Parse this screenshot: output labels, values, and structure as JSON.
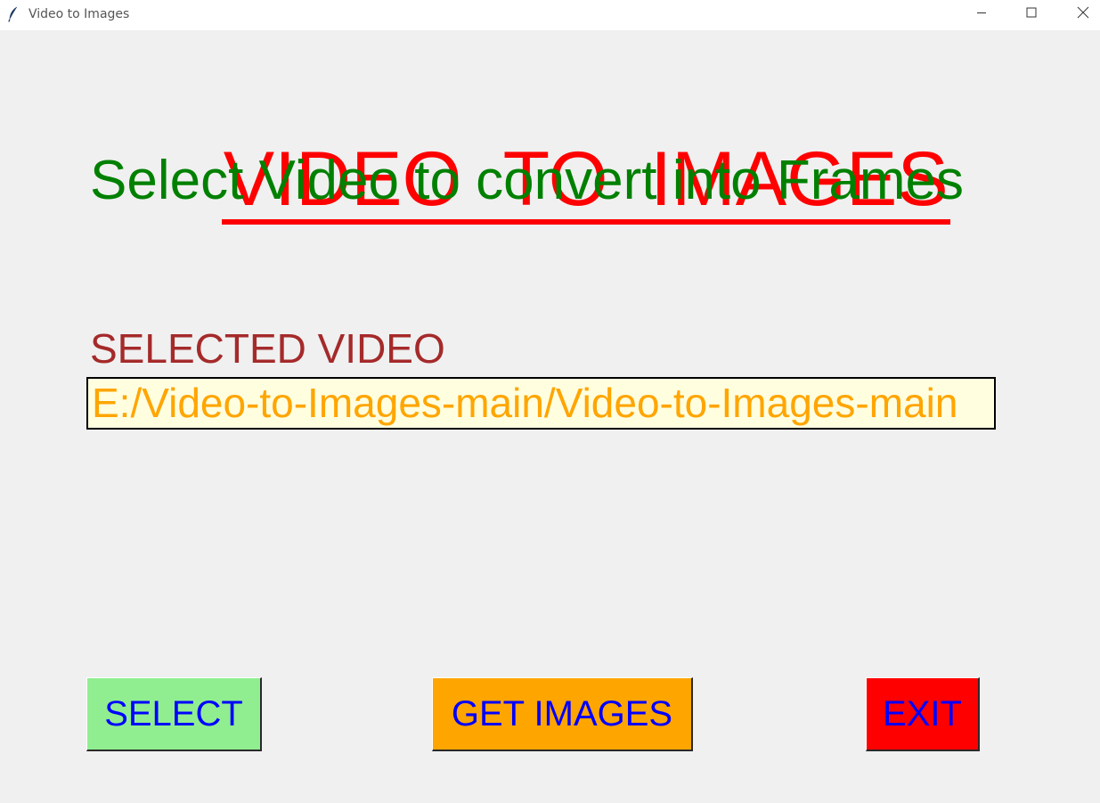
{
  "window": {
    "title": "Video to Images"
  },
  "heading": {
    "text": "VIDEO  TO  IMAGES",
    "color": "#ff0000"
  },
  "subtitle": {
    "text": "Select Video to convert into Frames",
    "color": "#008000"
  },
  "selected_video": {
    "label": "SELECTED VIDEO",
    "label_color": "#a52a2a",
    "value": "E:/Video-to-Images-main/Video-to-Images-main",
    "text_color": "#ffa500",
    "background": "#ffffe0"
  },
  "buttons": {
    "select": {
      "label": "SELECT",
      "bg": "#90ee90"
    },
    "get_images": {
      "label": "GET IMAGES",
      "bg": "#ffa500"
    },
    "exit": {
      "label": "EXIT",
      "bg": "#ff0000"
    },
    "text_color": "#0000ff"
  },
  "icons": {
    "app": "feather-icon",
    "minimize": "minimize-icon",
    "maximize": "maximize-icon",
    "close": "close-icon"
  }
}
